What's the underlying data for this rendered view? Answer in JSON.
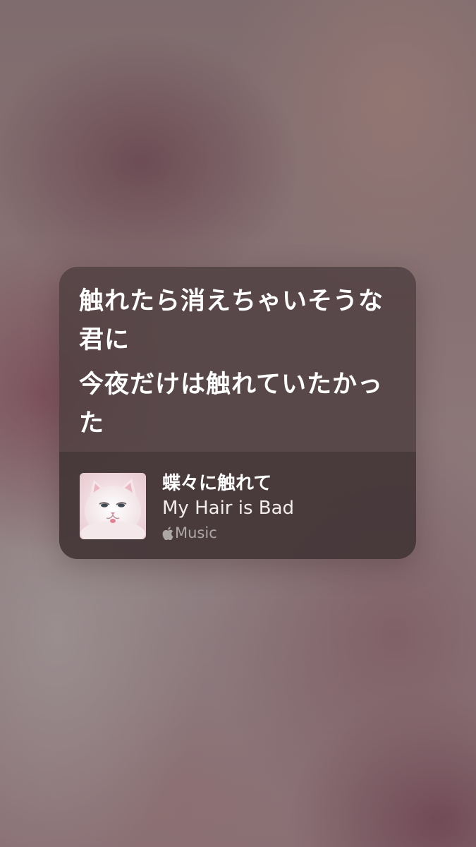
{
  "lyrics": {
    "line1": "触れたら消えちゃいそうな君に",
    "line2": "今夜だけは触れていたかった"
  },
  "track": {
    "title": "蝶々に触れて",
    "artist": "My Hair is Bad",
    "service_label": "Music",
    "service_icon": "apple-logo-icon",
    "artwork_icon": "cat-album-artwork"
  }
}
